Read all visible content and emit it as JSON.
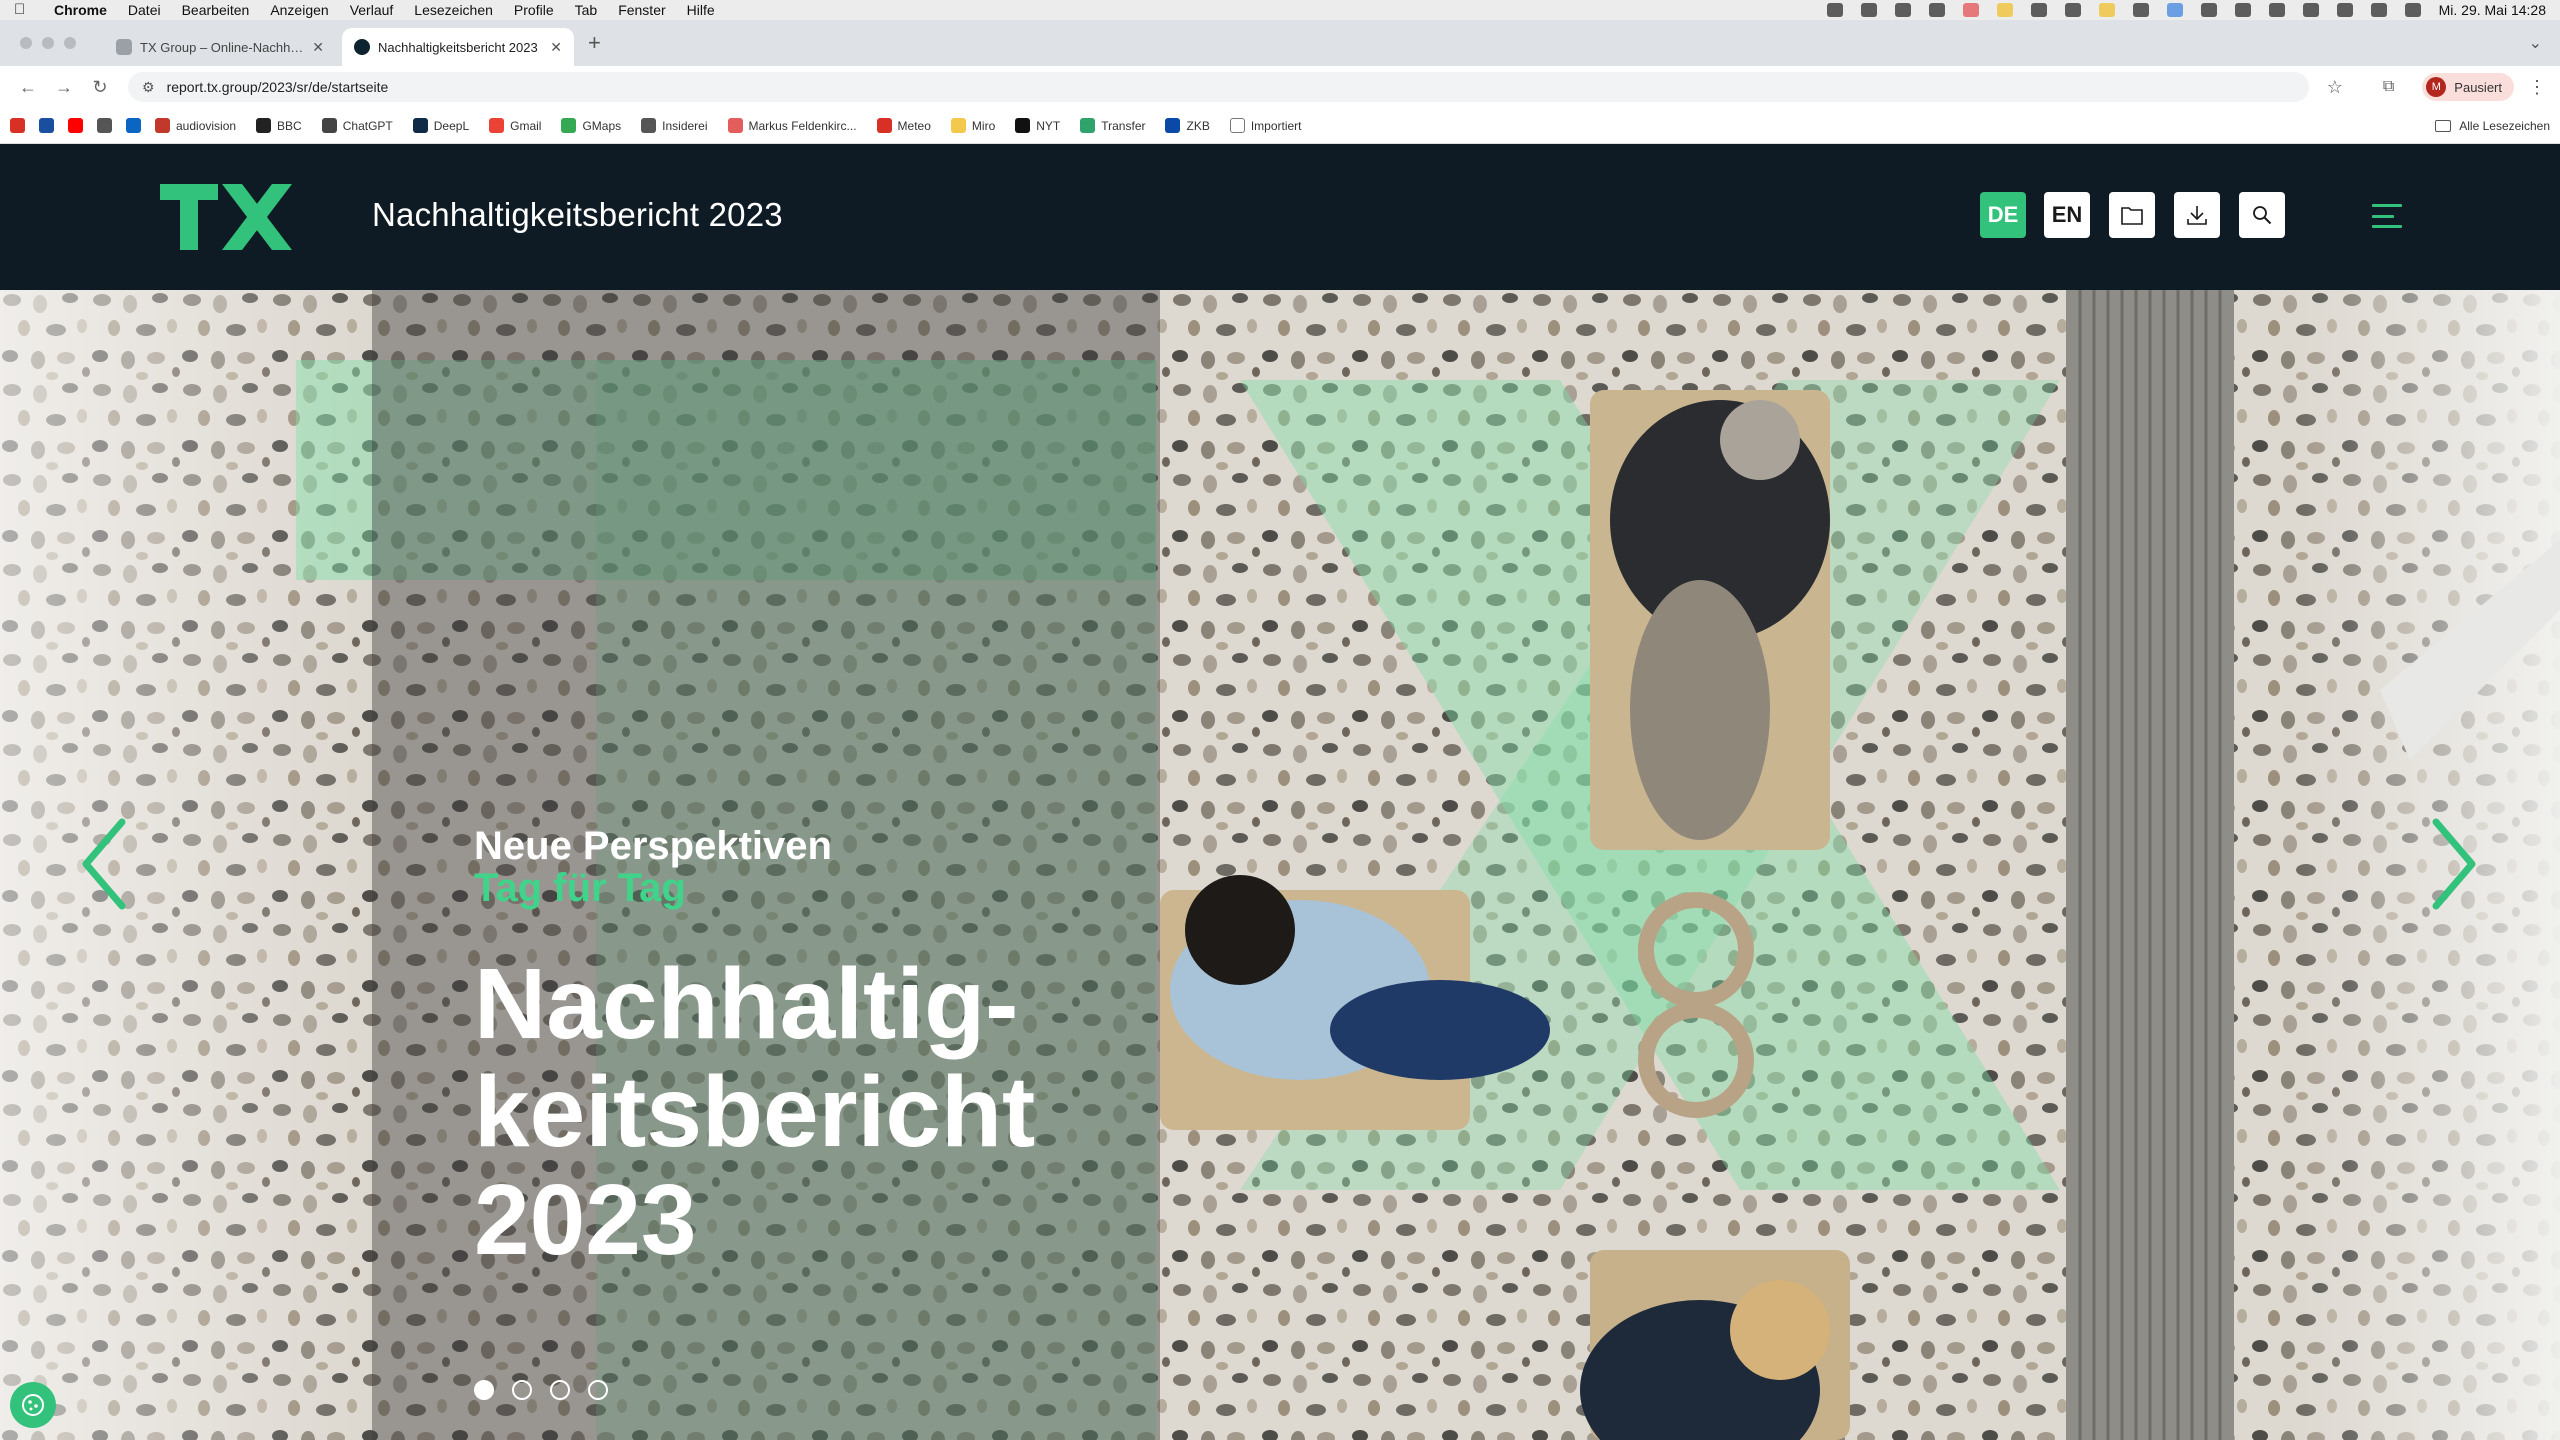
{
  "menubar": {
    "app": "Chrome",
    "items": [
      "Datei",
      "Bearbeiten",
      "Anzeigen",
      "Verlauf",
      "Lesezeichen",
      "Profile",
      "Tab",
      "Fenster",
      "Hilfe"
    ],
    "clock": "Mi. 29. Mai 14:28"
  },
  "tabs": [
    {
      "title": "TX Group – Online-Nachhaltigkeitsbericht",
      "active": false
    },
    {
      "title": "Nachhaltigkeitsbericht 2023",
      "active": true
    }
  ],
  "toolbar": {
    "url": "report.tx.group/2023/sr/de/startseite",
    "profile_initial": "M",
    "profile_label": "Pausiert"
  },
  "bookmarks": {
    "items": [
      {
        "label": "",
        "icon": "bookmark-red-icon",
        "color": "#d93025"
      },
      {
        "label": "",
        "icon": "bookmark-blue-icon",
        "color": "#1a4fa0"
      },
      {
        "label": "",
        "icon": "youtube-icon",
        "color": "#ff0000"
      },
      {
        "label": "",
        "icon": "wikipedia-icon",
        "color": "#555555"
      },
      {
        "label": "",
        "icon": "linkedin-icon",
        "color": "#0a66c2"
      },
      {
        "label": "audiovision",
        "icon": "audiovision-icon",
        "color": "#c0392b"
      },
      {
        "label": "BBC",
        "icon": "bbc-icon",
        "color": "#222222"
      },
      {
        "label": "ChatGPT",
        "icon": "chatgpt-icon",
        "color": "#444444"
      },
      {
        "label": "DeepL",
        "icon": "deepl-icon",
        "color": "#0f2b46"
      },
      {
        "label": "Gmail",
        "icon": "gmail-icon",
        "color": "#ea4335"
      },
      {
        "label": "GMaps",
        "icon": "gmaps-icon",
        "color": "#34a853"
      },
      {
        "label": "Insiderei",
        "icon": "insiderei-icon",
        "color": "#555555"
      },
      {
        "label": "Markus Feldenkirc...",
        "icon": "markus-icon",
        "color": "#e35d5d"
      },
      {
        "label": "Meteo",
        "icon": "meteo-icon",
        "color": "#d93025"
      },
      {
        "label": "Miro",
        "icon": "miro-icon",
        "color": "#f2c94c"
      },
      {
        "label": "NYT",
        "icon": "nyt-icon",
        "color": "#111111"
      },
      {
        "label": "Transfer",
        "icon": "transfer-icon",
        "color": "#2fa36b"
      },
      {
        "label": "ZKB",
        "icon": "zkb-icon",
        "color": "#0a4aa6"
      },
      {
        "label": "Importiert",
        "icon": "folder-icon",
        "color": "#777777"
      }
    ],
    "all_label": "Alle Lesezeichen"
  },
  "site": {
    "logo_alt": "TX",
    "title": "Nachhaltigkeitsbericht 2023",
    "lang_de": "DE",
    "lang_en": "EN",
    "accent_color": "#32c27b",
    "header_bg": "#0e1b24"
  },
  "hero": {
    "kicker_line1": "Neue Perspektiven",
    "kicker_line2": "Tag für Tag",
    "headline": "Nachhaltig-\nkeitsbericht\n2023",
    "slide_count": 4,
    "active_slide": 1
  }
}
